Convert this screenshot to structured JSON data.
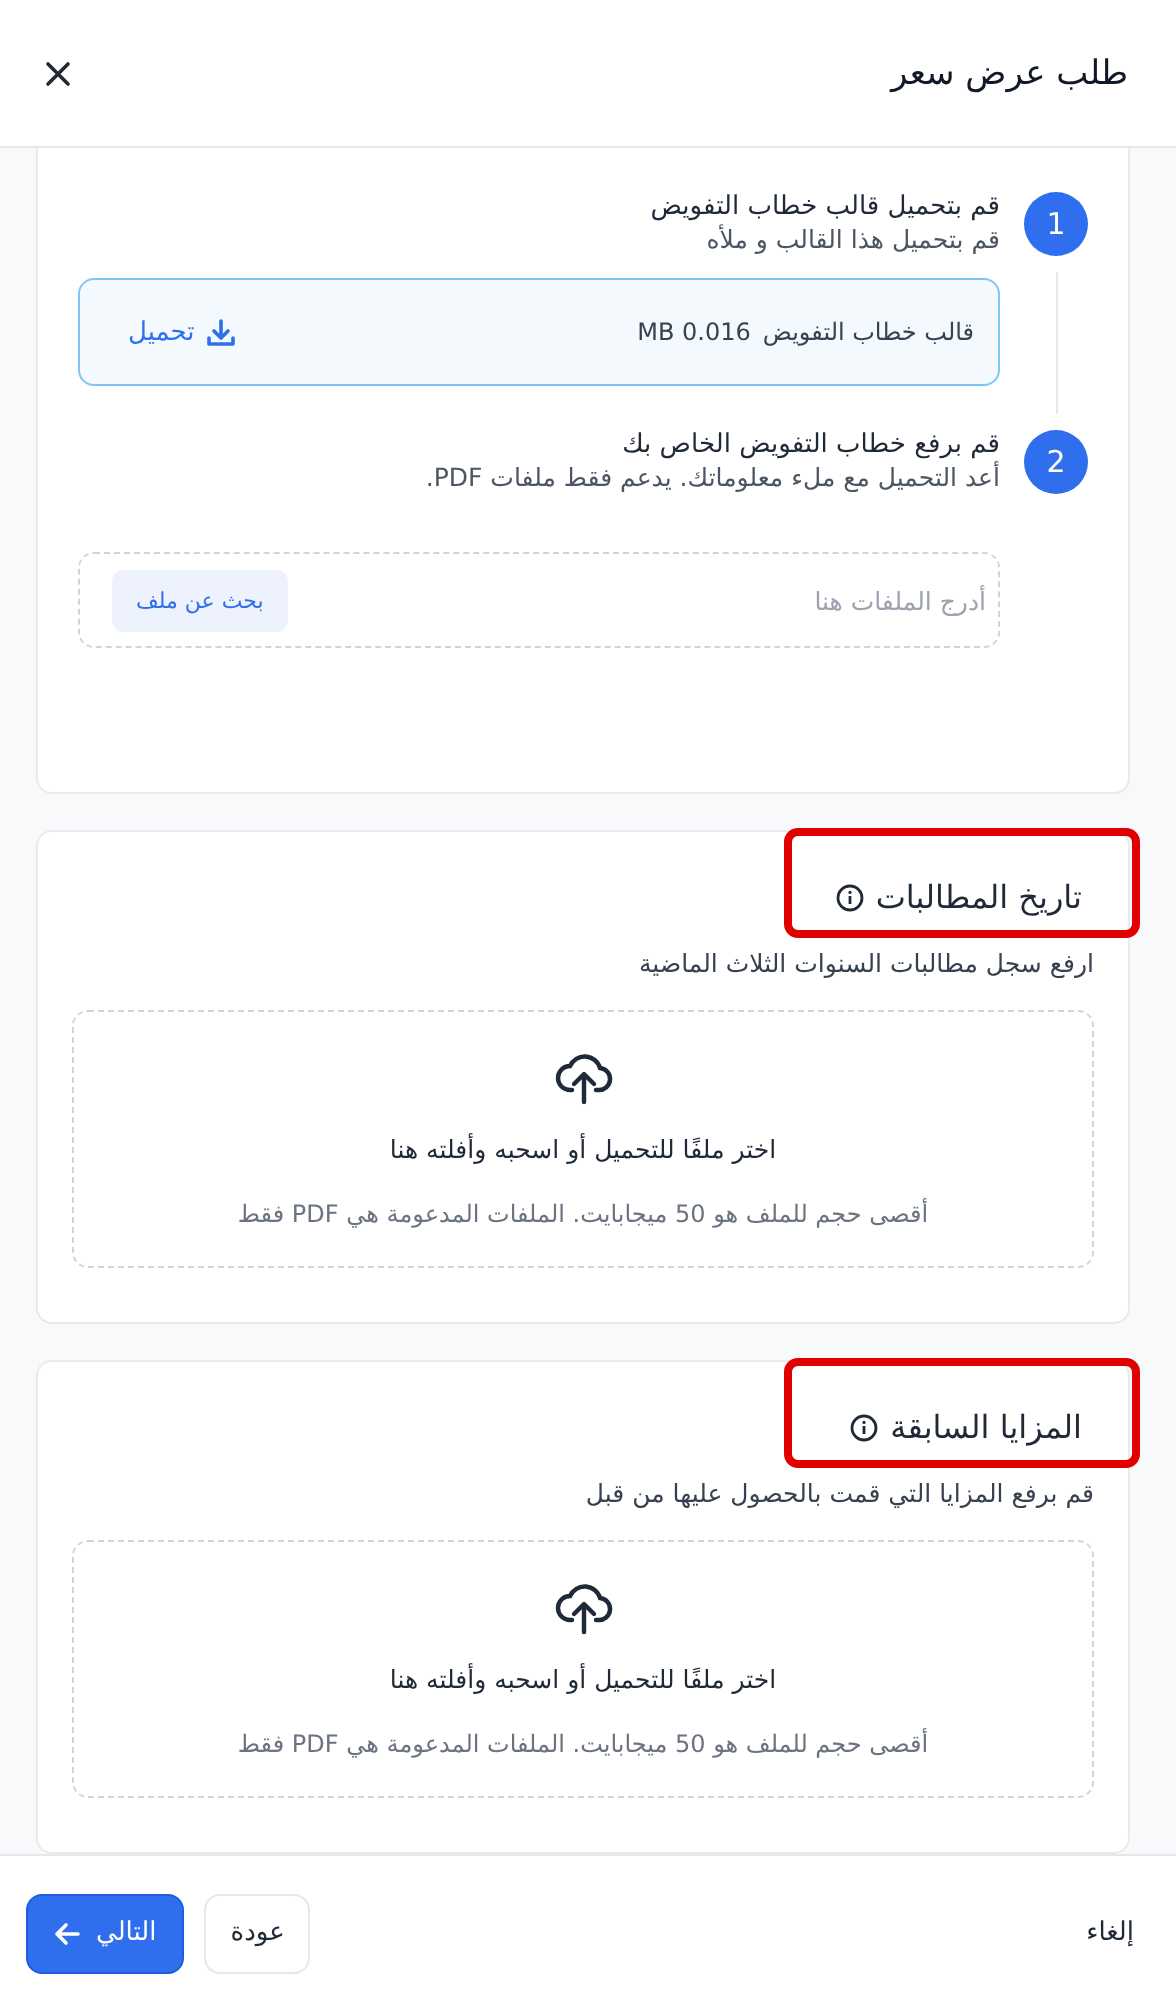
{
  "dialog": {
    "title": "طلب عرض سعر"
  },
  "steps": [
    {
      "number": "1",
      "title": "قم بتحميل قالب خطاب التفويض",
      "subtitle": "قم بتحميل هذا القالب و ملأه",
      "kind": "download",
      "file": {
        "name": "قالب خطاب التفويض",
        "size": "MB 0.016",
        "action": "تحميل"
      }
    },
    {
      "number": "2",
      "title": "قم برفع خطاب التفويض الخاص بك",
      "subtitle": "أعد التحميل مع ملء معلوماتك. يدعم فقط ملفات PDF.",
      "kind": "upload",
      "dropzone": {
        "placeholder": "أدرج الملفات هنا",
        "button": "بحث عن ملف"
      }
    }
  ],
  "sections": [
    {
      "title": "تاريخ المطالبات",
      "highlighted": true,
      "subtitle": "ارفع سجل مطالبات السنوات الثلاث الماضية",
      "prompt": "اختر ملفًا للتحميل أو اسحبه وأفلته هنا",
      "hint": "أقصى حجم للملف هو 50 ميجابايت. الملفات المدعومة هي PDF فقط"
    },
    {
      "title": "المزايا السابقة",
      "highlighted": true,
      "subtitle": "قم برفع المزايا التي قمت بالحصول عليها من قبل",
      "prompt": "اختر ملفًا للتحميل أو اسحبه وأفلته هنا",
      "hint": "أقصى حجم للملف هو 50 ميجابايت. الملفات المدعومة هي PDF فقط"
    }
  ],
  "footer": {
    "cancel": "إلغاء",
    "back": "عودة",
    "next": "التالي"
  }
}
